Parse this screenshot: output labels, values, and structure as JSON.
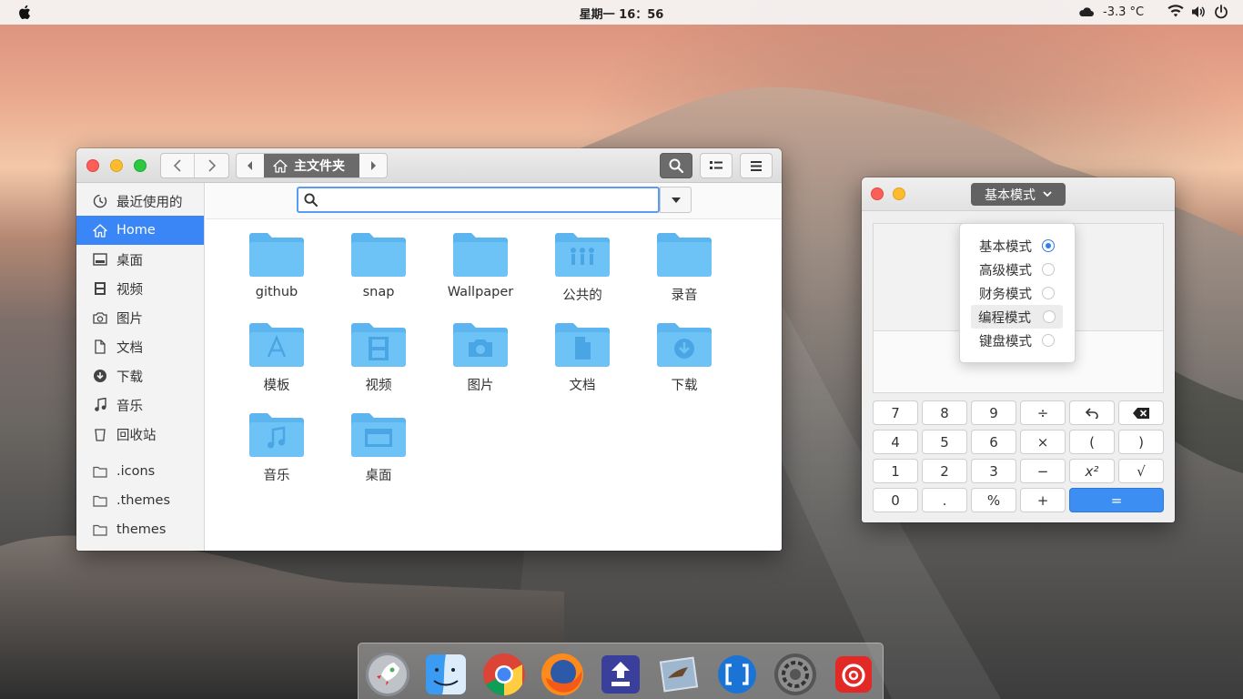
{
  "topbar": {
    "clock": "星期一 16：56",
    "temperature": "-3.3 °C",
    "icons": [
      "apple-logo",
      "cloud-icon",
      "wifi-icon",
      "volume-icon",
      "power-icon"
    ]
  },
  "file_manager": {
    "path_location": "主文件夹",
    "search": {
      "value": "",
      "placeholder": ""
    },
    "sidebar": {
      "items": [
        {
          "label": "最近使用的",
          "icon": "recent-icon"
        },
        {
          "label": "Home",
          "icon": "home-icon",
          "active": true
        },
        {
          "label": "桌面",
          "icon": "desktop-icon"
        },
        {
          "label": "视频",
          "icon": "video-icon"
        },
        {
          "label": "图片",
          "icon": "picture-icon"
        },
        {
          "label": "文档",
          "icon": "document-icon"
        },
        {
          "label": "下载",
          "icon": "download-icon"
        },
        {
          "label": "音乐",
          "icon": "music-icon"
        },
        {
          "label": "回收站",
          "icon": "trash-icon"
        }
      ],
      "bookmarks": [
        {
          "label": ".icons",
          "icon": "folder-icon"
        },
        {
          "label": ".themes",
          "icon": "folder-icon"
        },
        {
          "label": "themes",
          "icon": "folder-icon"
        }
      ]
    },
    "folders": [
      {
        "label": "github",
        "emblem": "none"
      },
      {
        "label": "snap",
        "emblem": "none"
      },
      {
        "label": "Wallpaper",
        "emblem": "none"
      },
      {
        "label": "公共的",
        "emblem": "people"
      },
      {
        "label": "录音",
        "emblem": "none"
      },
      {
        "label": "模板",
        "emblem": "template"
      },
      {
        "label": "视频",
        "emblem": "film"
      },
      {
        "label": "图片",
        "emblem": "camera"
      },
      {
        "label": "文档",
        "emblem": "document"
      },
      {
        "label": "下载",
        "emblem": "download"
      },
      {
        "label": "音乐",
        "emblem": "music"
      },
      {
        "label": "桌面",
        "emblem": "desktop"
      }
    ]
  },
  "calculator": {
    "mode_button": "基本模式",
    "mode_menu": [
      {
        "label": "基本模式",
        "selected": true
      },
      {
        "label": "高级模式",
        "selected": false
      },
      {
        "label": "财务模式",
        "selected": false
      },
      {
        "label": "编程模式",
        "selected": false,
        "hovered": true
      },
      {
        "label": "键盘模式",
        "selected": false
      }
    ],
    "keys": [
      [
        "7",
        "8",
        "9",
        "÷",
        "undo",
        "backspace"
      ],
      [
        "4",
        "5",
        "6",
        "×",
        "(",
        ")"
      ],
      [
        "1",
        "2",
        "3",
        "−",
        "x²",
        "√"
      ],
      [
        "0",
        ".",
        "%",
        "+",
        "="
      ]
    ]
  },
  "dock": {
    "apps": [
      "launchpad",
      "finder",
      "chrome",
      "firefox",
      "app-store",
      "mail",
      "bracket-app",
      "system-settings",
      "netease-music"
    ]
  },
  "colors": {
    "accent": "#3b86f7",
    "path_active": "#6b6b6b"
  }
}
